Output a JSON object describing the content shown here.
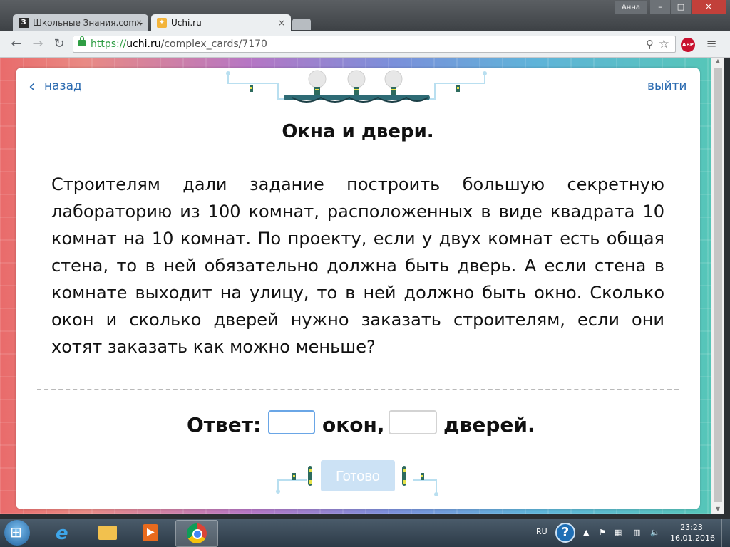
{
  "window": {
    "user": "Анна",
    "min_label": "–",
    "max_label": "□",
    "close_label": "✕"
  },
  "tabs": [
    {
      "favicon": "З",
      "title": "Школьные Знания.com -",
      "close": "×"
    },
    {
      "favicon": "✦",
      "title": "Uchi.ru",
      "close": "×"
    }
  ],
  "toolbar": {
    "back": "←",
    "forward": "→",
    "reload": "↻",
    "url_scheme": "https://",
    "url_host": "uchi.ru",
    "url_path": "/complex_cards/7170",
    "zoom_icon": "⚲",
    "star_icon": "☆",
    "abp_label": "ABP",
    "menu_icon": "≡"
  },
  "page": {
    "back_chevron": "‹",
    "back_label": "назад",
    "exit_label": "выйти",
    "title": "Окна и двери.",
    "task": "Строителям дали задание построить большую секретную лабораторию из 100 комнат, расположенных в виде квадрата 10 комнат на 10 комнат. По проекту, если у двух комнат есть общая стена, то в ней обязательно должна быть дверь. А если стена в комнате выходит на улицу, то в ней должно быть окно. Сколько окон и сколько дверей нужно заказать строителям, если они хотят заказать как можно меньше?",
    "answer_label": "Ответ:",
    "windows_value": "",
    "windows_word": "окон,",
    "doors_value": "",
    "doors_word": "дверей.",
    "ready_label": "Готово"
  },
  "taskbar": {
    "lang": "RU",
    "help": "?",
    "tray1": "▲",
    "tray2": "⚑",
    "tray3": "▦",
    "tray4": "▥",
    "tray5": "🔈",
    "time": "23:23",
    "date": "16.01.2016"
  },
  "colors": {
    "link": "#2a6ab0",
    "input_focus": "#6aa6e6",
    "ready_button": "#cce2f5"
  }
}
